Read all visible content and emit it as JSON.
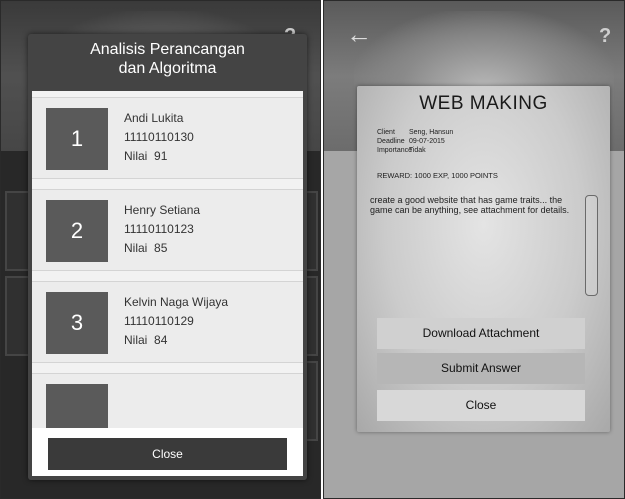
{
  "left": {
    "modal": {
      "title_line1": "Analisis Perancangan",
      "title_line2": "dan Algoritma",
      "items": [
        {
          "rank": "1",
          "name": "Andi Lukita",
          "id": "11110110130",
          "score_label": "Nilai",
          "score": "91"
        },
        {
          "rank": "2",
          "name": "Henry Setiana",
          "id": "11110110123",
          "score_label": "Nilai",
          "score": "85"
        },
        {
          "rank": "3",
          "name": "Kelvin Naga Wijaya",
          "id": "11110110129",
          "score_label": "Nilai",
          "score": "84"
        }
      ],
      "close_label": "Close"
    },
    "back_icon": "back-arrow-icon",
    "help_icon": "question-mark-icon"
  },
  "right": {
    "card": {
      "title": "WEB MAKING",
      "client_label": "Client",
      "client": "Seng, Hansun",
      "deadline_label": "Deadline",
      "deadline": "09-07-2015",
      "importance_label": "Importance",
      "importance": "Tidak",
      "reward": "REWARD:  1000 EXP, 1000 POINTS",
      "description": "create a good website that has game traits...  the game can be anything, see attachment for details.",
      "download_label": "Download Attachment",
      "submit_label": "Submit Answer",
      "close_label": "Close"
    },
    "back_icon": "back-arrow-icon",
    "help_icon": "question-mark-icon"
  }
}
